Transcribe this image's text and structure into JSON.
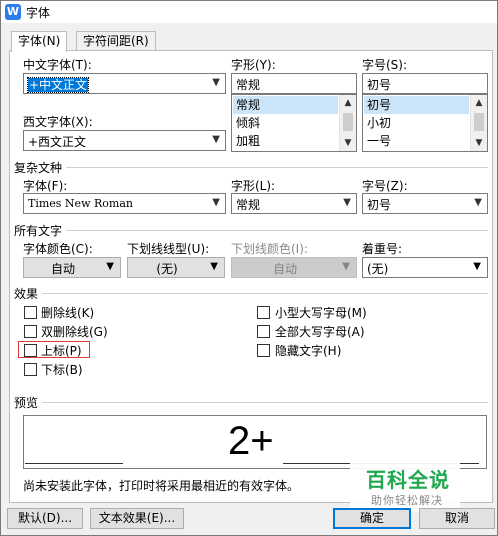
{
  "window": {
    "icon_letter": "W",
    "title": "字体"
  },
  "tabs": [
    {
      "label": "字体(N)"
    },
    {
      "label": "字符间距(R)"
    }
  ],
  "latin_asian": {
    "chinese_font_label": "中文字体(T):",
    "chinese_font_value": "+中文正文",
    "western_font_label": "西文字体(X):",
    "western_font_value": "+西文正文",
    "style_label": "字形(Y):",
    "style_value": "常规",
    "style_options": [
      "常规",
      "倾斜",
      "加粗"
    ],
    "size_label": "字号(S):",
    "size_value": "初号",
    "size_options": [
      "初号",
      "小初",
      "一号"
    ]
  },
  "complex_script": {
    "section_title": "复杂文种",
    "font_label": "字体(F):",
    "font_value": "Times New Roman",
    "style_label": "字形(L):",
    "style_value": "常规",
    "size_label": "字号(Z):",
    "size_value": "初号"
  },
  "all_text": {
    "section_title": "所有文字",
    "font_color_label": "字体颜色(C):",
    "font_color_value": "自动",
    "underline_type_label": "下划线线型(U):",
    "underline_type_value": "(无)",
    "underline_color_label": "下划线颜色(I):",
    "underline_color_value": "自动",
    "emphasis_label": "着重号:",
    "emphasis_value": "(无)"
  },
  "effects": {
    "section_title": "效果",
    "left": [
      {
        "label": "删除线(K)",
        "checked": false
      },
      {
        "label": "双删除线(G)",
        "checked": false
      },
      {
        "label": "上标(P)",
        "checked": false
      },
      {
        "label": "下标(B)",
        "checked": false
      }
    ],
    "right": [
      {
        "label": "小型大写字母(M)",
        "checked": false
      },
      {
        "label": "全部大写字母(A)",
        "checked": false
      },
      {
        "label": "隐藏文字(H)",
        "checked": false
      }
    ]
  },
  "preview": {
    "section_title": "预览",
    "sample_text": "2+",
    "note": "尚未安装此字体，打印时将采用最相近的有效字体。"
  },
  "watermark": {
    "brand": "百科全说",
    "tagline": "助你轻松解决"
  },
  "buttons": {
    "default": "默认(D)...",
    "text_effects": "文本效果(E)...",
    "ok": "确定",
    "cancel": "取消"
  },
  "colors": {
    "selection": "#0078d7",
    "list_highlight": "#cce4f7",
    "focus_outline": "#e03c3c",
    "watermark_green": "#1fa84f"
  },
  "icons": [
    "dropdown-arrow-icon",
    "scroll-up-icon",
    "scroll-down-icon",
    "word-app-icon"
  ]
}
